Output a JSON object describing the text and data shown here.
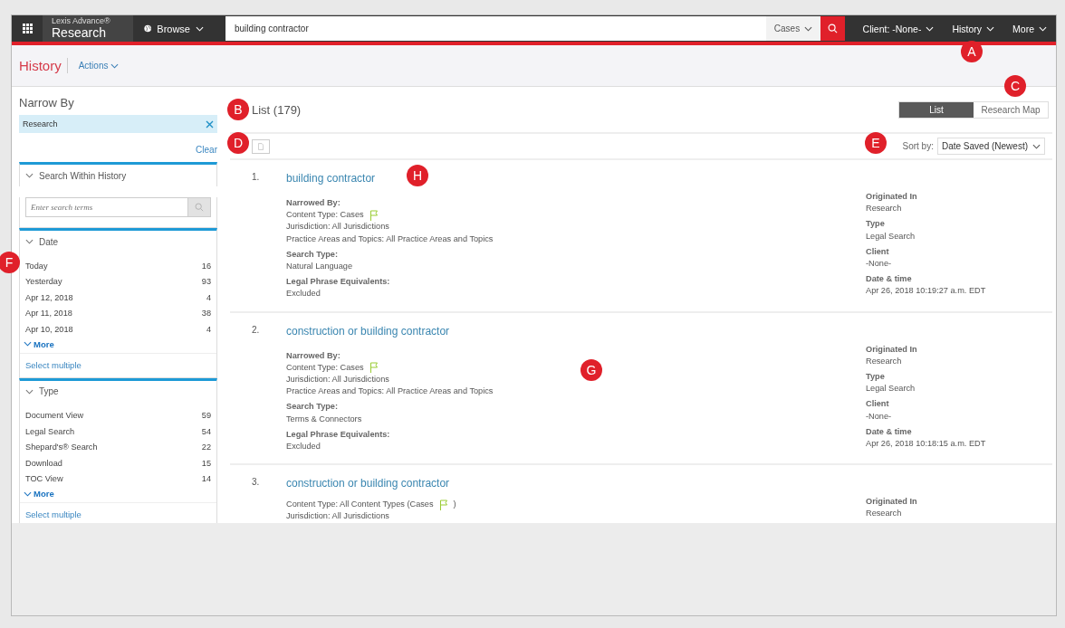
{
  "topbar": {
    "logo_small": "Lexis Advance®",
    "logo_big": "Research",
    "browse": "Browse",
    "search_value": "building contractor",
    "scope": "Cases",
    "client": "Client: -None-",
    "history": "History",
    "more": "More"
  },
  "subheader": {
    "title": "History",
    "actions": "Actions"
  },
  "sidebar": {
    "title": "Narrow By",
    "chip": "Research",
    "clear": "Clear",
    "search_section": {
      "title": "Search Within History",
      "expanded": true,
      "placeholder": "Enter search terms"
    },
    "facets": [
      {
        "title": "Date",
        "expanded": true,
        "items": [
          {
            "label": "Today",
            "count": "16"
          },
          {
            "label": "Yesterday",
            "count": "93"
          },
          {
            "label": "Apr 12, 2018",
            "count": "4"
          },
          {
            "label": "Apr 11, 2018",
            "count": "38"
          },
          {
            "label": "Apr 10, 2018",
            "count": "4"
          }
        ],
        "more": "More",
        "select": "Select multiple"
      },
      {
        "title": "Type",
        "expanded": true,
        "items": [
          {
            "label": "Document View",
            "count": "59"
          },
          {
            "label": "Legal Search",
            "count": "54"
          },
          {
            "label": "Shepard's® Search",
            "count": "22"
          },
          {
            "label": "Download",
            "count": "15"
          },
          {
            "label": "TOC View",
            "count": "14"
          }
        ],
        "more": "More",
        "select": "Select multiple"
      }
    ]
  },
  "main": {
    "heading": "List (179)",
    "views": [
      {
        "label": "List",
        "selected": true
      },
      {
        "label": "Research Map",
        "selected": false
      }
    ],
    "sort_label": "Sort by:",
    "sort_value": "Date Saved (Newest)",
    "results": [
      {
        "number": "1.",
        "title": "building contractor",
        "left": [
          {
            "kind": "label",
            "text": "Narrowed By:"
          },
          {
            "kind": "value",
            "text": "Content Type: Cases",
            "flag": true
          },
          {
            "kind": "value",
            "text": "Jurisdiction: All Jurisdictions",
            "flag": false
          },
          {
            "kind": "value",
            "text": "Practice Areas and Topics: All Practice Areas and Topics",
            "flag": false
          },
          {
            "kind": "label",
            "text": "Search Type:"
          },
          {
            "kind": "value",
            "text": "Natural Language",
            "flag": false
          },
          {
            "kind": "label",
            "text": "Legal Phrase Equivalents:"
          },
          {
            "kind": "value",
            "text": "Excluded",
            "flag": false
          }
        ],
        "right": [
          {
            "kind": "label",
            "text": "Originated In"
          },
          {
            "kind": "value",
            "text": "Research"
          },
          {
            "kind": "label",
            "text": "Type"
          },
          {
            "kind": "value",
            "text": "Legal Search"
          },
          {
            "kind": "label",
            "text": "Client"
          },
          {
            "kind": "value",
            "text": "-None-"
          },
          {
            "kind": "label",
            "text": "Date & time"
          },
          {
            "kind": "value",
            "text": "Apr 26, 2018   10:19:27 a.m. EDT"
          }
        ]
      },
      {
        "number": "2.",
        "title": "construction or building contractor",
        "left": [
          {
            "kind": "label",
            "text": "Narrowed By:"
          },
          {
            "kind": "value",
            "text": "Content Type: Cases",
            "flag": true
          },
          {
            "kind": "value",
            "text": "Jurisdiction: All Jurisdictions",
            "flag": false
          },
          {
            "kind": "value",
            "text": "Practice Areas and Topics: All Practice Areas and Topics",
            "flag": false
          },
          {
            "kind": "label",
            "text": "Search Type:"
          },
          {
            "kind": "value",
            "text": "Terms & Connectors",
            "flag": false
          },
          {
            "kind": "label",
            "text": "Legal Phrase Equivalents:"
          },
          {
            "kind": "value",
            "text": "Excluded",
            "flag": false
          }
        ],
        "right": [
          {
            "kind": "label",
            "text": "Originated In"
          },
          {
            "kind": "value",
            "text": "Research"
          },
          {
            "kind": "label",
            "text": "Type"
          },
          {
            "kind": "value",
            "text": "Legal Search"
          },
          {
            "kind": "label",
            "text": "Client"
          },
          {
            "kind": "value",
            "text": "-None-"
          },
          {
            "kind": "label",
            "text": "Date & time"
          },
          {
            "kind": "value",
            "text": "Apr 26, 2018   10:18:15 a.m. EDT"
          }
        ]
      },
      {
        "number": "3.",
        "title": "construction or building contractor",
        "left": [
          {
            "kind": "value",
            "text": "Content Type: All Content Types (Cases",
            "flag": true,
            "after": ")"
          },
          {
            "kind": "value",
            "text": "Jurisdiction: All Jurisdictions",
            "flag": false
          }
        ],
        "right": [
          {
            "kind": "label",
            "text": "Originated In"
          },
          {
            "kind": "value",
            "text": "Research"
          }
        ]
      }
    ]
  },
  "callouts": [
    {
      "label": "A"
    },
    {
      "label": "B"
    },
    {
      "label": "C"
    },
    {
      "label": "D"
    },
    {
      "label": "E"
    },
    {
      "label": "F"
    },
    {
      "label": "G"
    },
    {
      "label": "H"
    }
  ]
}
